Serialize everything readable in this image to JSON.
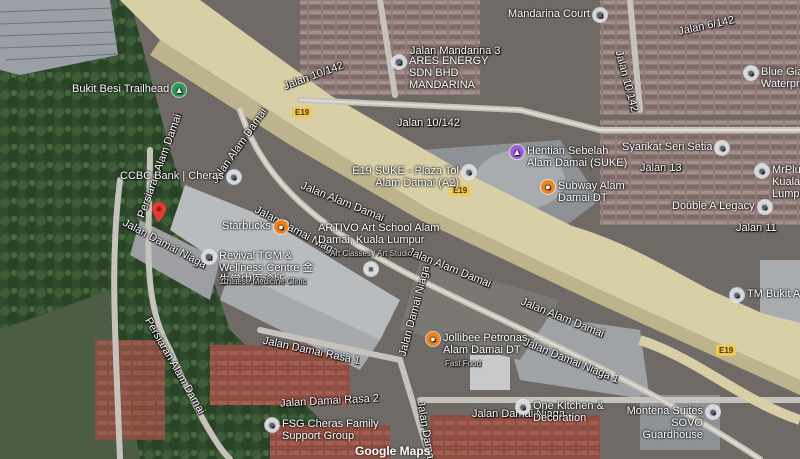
{
  "map": {
    "attribution": "Google Maps",
    "roads": {
      "jalan_10_142_a": "Jalan 10/142",
      "jalan_10_142_b": "Jalan 10/142",
      "jalan_alam_damai_upper": "Jalan Alam Damai",
      "jalan_alam_damai_mid": "Jalan Alam Damai",
      "jalan_alam_damai_left": "Jalan Alam Damai",
      "jalan_alam_damai_lower": "Jalan Alam Damai",
      "jalan_damai_niaga_left": "Jalan Damai Niaga",
      "jalan_damai_niaga_mid": "Jalan Damai Niaga",
      "jalan_damai_niaga_1": "Jalan Damai Niaga 1",
      "jalan_damai_niaga_bottom": "Jalan Damai Niaga",
      "jalan_damai_niaga_diag": "Jalan Damai Niaga",
      "persiaran_alam_damai_top": "Persiaran Alam Damai",
      "persiaran_alam_damai_bottom": "Persiaran Alam Damai",
      "jalan_damai_rasa_1": "Jalan Damai Rasa 1",
      "jalan_damai_rasa_2": "Jalan Damai Rasa 2",
      "jalan_damai_vertical": "Jalan Damai",
      "jalan_mandarina_3": "Jalan Mandarina 3",
      "jalan_6_142": "Jalan 6/142",
      "jalan_10_142_vert": "Jalan 10/142",
      "jalan_13": "Jalan 13",
      "jalan_11": "Jalan 11"
    },
    "highways": [
      "E19",
      "E19",
      "E19"
    ],
    "pois": [
      {
        "name": "Bukit Besi Trailhead",
        "icon": "hiking-icon",
        "color": "green"
      },
      {
        "name": "CCBC Bank | Cheras",
        "icon": "bank-icon",
        "color": "grey"
      },
      {
        "name": "Mandarina Court",
        "icon": "building-icon",
        "color": "grey"
      },
      {
        "name": "ARES ENERGY SDN BHD MANDARINA",
        "icon": "building-icon",
        "color": "grey"
      },
      {
        "name": "Blue Giant Waterproof",
        "icon": "business-icon",
        "color": "grey"
      },
      {
        "name": "Hentian Sebelah Alam Damai (SUKE)",
        "icon": "rest-area-icon",
        "color": "purple"
      },
      {
        "name": "E19 SUKE - Plaza Tol Alam Damai (A2)",
        "icon": "toll-icon",
        "color": "grey"
      },
      {
        "name": "Subway Alam Damai DT",
        "icon": "restaurant-icon",
        "color": "orange"
      },
      {
        "name": "Syarikat Seri Setia",
        "icon": "business-icon",
        "color": "grey"
      },
      {
        "name": "MrPlus Kuala Lumpur",
        "icon": "business-icon",
        "color": "grey"
      },
      {
        "name": "Double A Legacy",
        "icon": "business-icon",
        "color": "grey"
      },
      {
        "name": "Starbucks",
        "icon": "cafe-icon",
        "color": "orange"
      },
      {
        "name": "ARTIVO Art School Alam Damai, Kuala Lumpur",
        "icon": "school-icon",
        "color": "grey"
      },
      {
        "name": "Art Classes / Art Studio",
        "icon": "",
        "color": "grey"
      },
      {
        "name": "Revival TCM & Wellness Centre 金生堂中医诊所",
        "icon": "clinic-icon",
        "color": "grey"
      },
      {
        "name": "Chinese Medicine Clinic",
        "icon": "",
        "color": "grey"
      },
      {
        "name": "Jollibee Petronas Alam Damai DT",
        "icon": "restaurant-icon",
        "color": "orange"
      },
      {
        "name": "Fast Food",
        "icon": "",
        "color": "grey"
      },
      {
        "name": "TM Bukit Anggrek",
        "icon": "business-icon",
        "color": "grey"
      },
      {
        "name": "One Kitchen & Decoration",
        "icon": "shop-icon",
        "color": "grey"
      },
      {
        "name": "Montena Suites SOVO Guardhouse",
        "icon": "building-icon",
        "color": "grey"
      },
      {
        "name": "FSG Cheras Family Support Group",
        "icon": "group-icon",
        "color": "grey"
      }
    ]
  }
}
